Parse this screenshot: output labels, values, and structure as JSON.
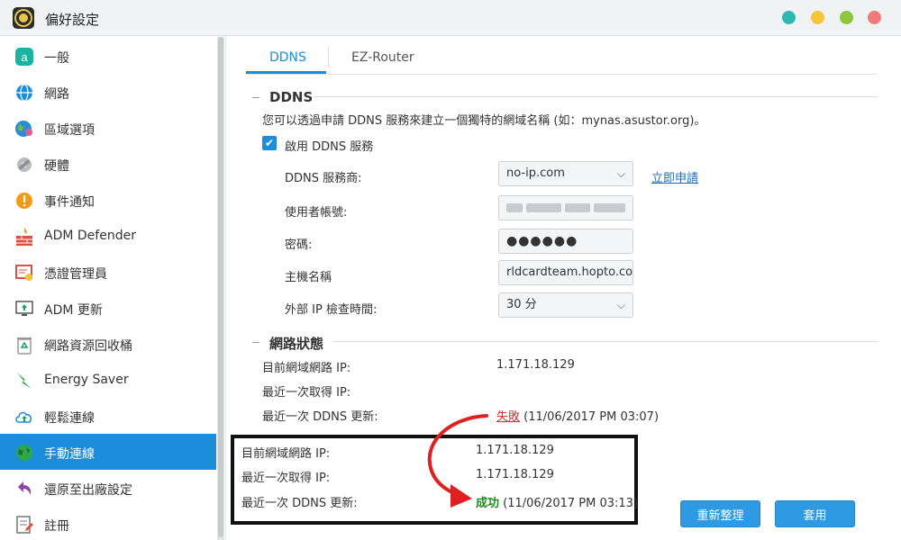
{
  "window": {
    "title": "偏好設定"
  },
  "sidebar": {
    "items": [
      {
        "label": "一般",
        "icon": "general-icon"
      },
      {
        "label": "網路",
        "icon": "globe-icon"
      },
      {
        "label": "區域選項",
        "icon": "region-icon"
      },
      {
        "label": "硬體",
        "icon": "hardware-icon"
      },
      {
        "label": "事件通知",
        "icon": "alert-icon"
      },
      {
        "label": "ADM Defender",
        "icon": "firewall-icon"
      },
      {
        "label": "憑證管理員",
        "icon": "certificate-icon"
      },
      {
        "label": "ADM 更新",
        "icon": "update-icon"
      },
      {
        "label": "網路資源回收桶",
        "icon": "recycle-icon"
      },
      {
        "label": "Energy Saver",
        "icon": "energy-icon"
      },
      {
        "label": "輕鬆連線",
        "icon": "cloud-icon"
      },
      {
        "label": "手動連線",
        "icon": "manual-connect-icon"
      },
      {
        "label": "還原至出廠設定",
        "icon": "restore-icon"
      },
      {
        "label": "註冊",
        "icon": "register-icon"
      }
    ],
    "active_index": 11
  },
  "tabs": {
    "ddns": "DDNS",
    "ez_router": "EZ-Router"
  },
  "ddns": {
    "section_title": "DDNS",
    "description": "您可以透過申請 DDNS 服務來建立一個獨特的網域名稱 (如：mynas.asustor.org)。",
    "enable_label": "啟用 DDNS 服務",
    "provider_label": "DDNS 服務商:",
    "provider_value": "no-ip.com",
    "apply_link": "立即申請",
    "username_label": "使用者帳號:",
    "password_label": "密碼:",
    "password_value": "●●●●●●",
    "hostname_label": "主機名稱",
    "hostname_value": "rldcardteam.hopto.com",
    "check_interval_label": "外部 IP 檢查時間:",
    "check_interval_value": "30 分"
  },
  "status": {
    "section_title": "網路狀態",
    "current_ip_label": "目前網域網路 IP:",
    "current_ip_value": "1.171.18.129",
    "last_ip_label": "最近一次取得 IP:",
    "last_ip_value": "",
    "last_update_label": "最近一次 DDNS 更新:",
    "last_update_status": "失敗",
    "last_update_time": "(11/06/2017 PM 03:07)"
  },
  "callout": {
    "current_ip_label": "目前網域網路 IP:",
    "current_ip_value": "1.171.18.129",
    "last_ip_label": "最近一次取得 IP:",
    "last_ip_value": "1.171.18.129",
    "last_update_label": "最近一次 DDNS 更新:",
    "last_update_status": "成功",
    "last_update_time": "(11/06/2017 PM 03:13)"
  },
  "buttons": {
    "refresh": "重新整理",
    "apply": "套用"
  },
  "colors": {
    "accent": "#1c8ddb",
    "fail": "#d2322d",
    "success": "#1f8a1f",
    "arrow": "#e02020"
  }
}
